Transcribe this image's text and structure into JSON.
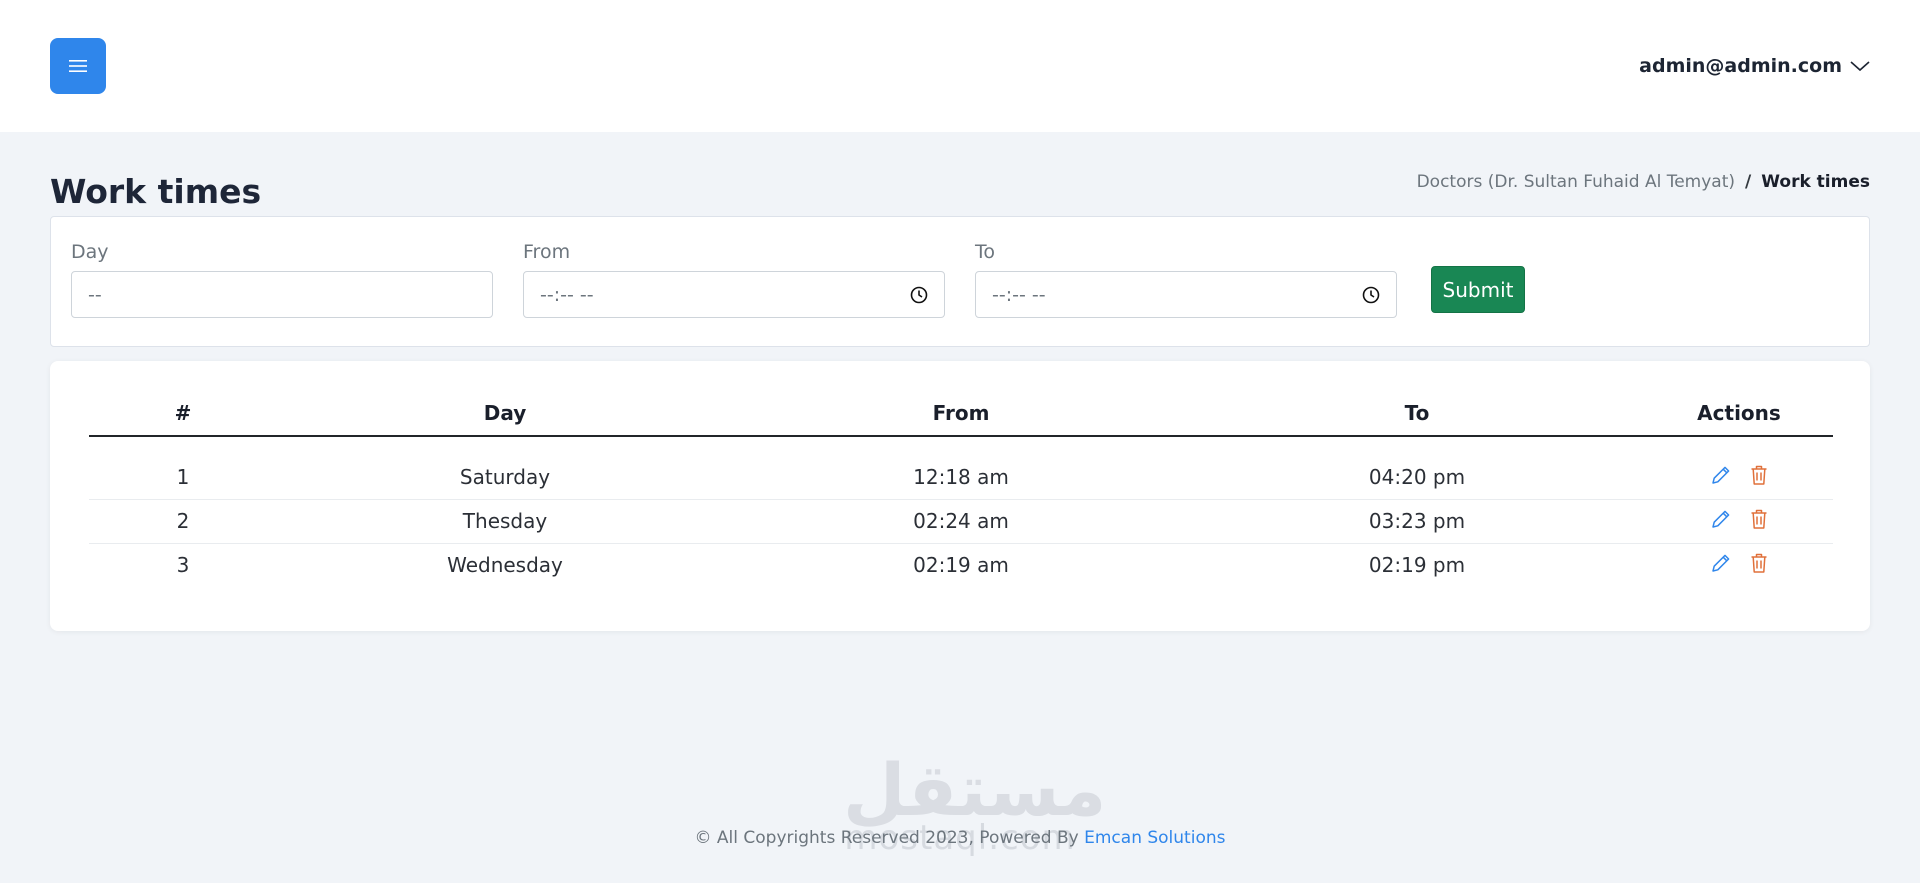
{
  "header": {
    "menu_icon": "hamburger-icon",
    "user_email": "admin@admin.com",
    "user_chevron_icon": "chevron-down-icon",
    "accent_color": "#2f86eb"
  },
  "page": {
    "title": "Work times",
    "breadcrumb": {
      "parent": "Doctors (Dr. Sultan Fuhaid Al Temyat)",
      "separator": "/",
      "current": "Work times"
    }
  },
  "form": {
    "day": {
      "label": "Day",
      "value": "--"
    },
    "from": {
      "label": "From",
      "value": "--:-- --",
      "icon": "clock-icon"
    },
    "to": {
      "label": "To",
      "value": "--:-- --",
      "icon": "clock-icon"
    },
    "submit_label": "Submit",
    "submit_color": "#198754"
  },
  "table": {
    "headers": [
      "#",
      "Day",
      "From",
      "To",
      "Actions"
    ],
    "rows": [
      {
        "num": "1",
        "day": "Saturday",
        "from": "12:18 am",
        "to": "04:20 pm"
      },
      {
        "num": "2",
        "day": "Thesday",
        "from": "02:24 am",
        "to": "03:23 pm"
      },
      {
        "num": "3",
        "day": "Wednesday",
        "from": "02:19 am",
        "to": "02:19 pm"
      }
    ],
    "edit_icon": "pencil-icon",
    "delete_icon": "trash-icon",
    "edit_color": "#2f86eb",
    "delete_color": "#e0703a"
  },
  "watermark": {
    "arabic": "مستقل",
    "latin": "mostaql.com"
  },
  "footer": {
    "text": "© All Copyrights Reserved 2023, Powered By",
    "link": "Emcan Solutions"
  }
}
